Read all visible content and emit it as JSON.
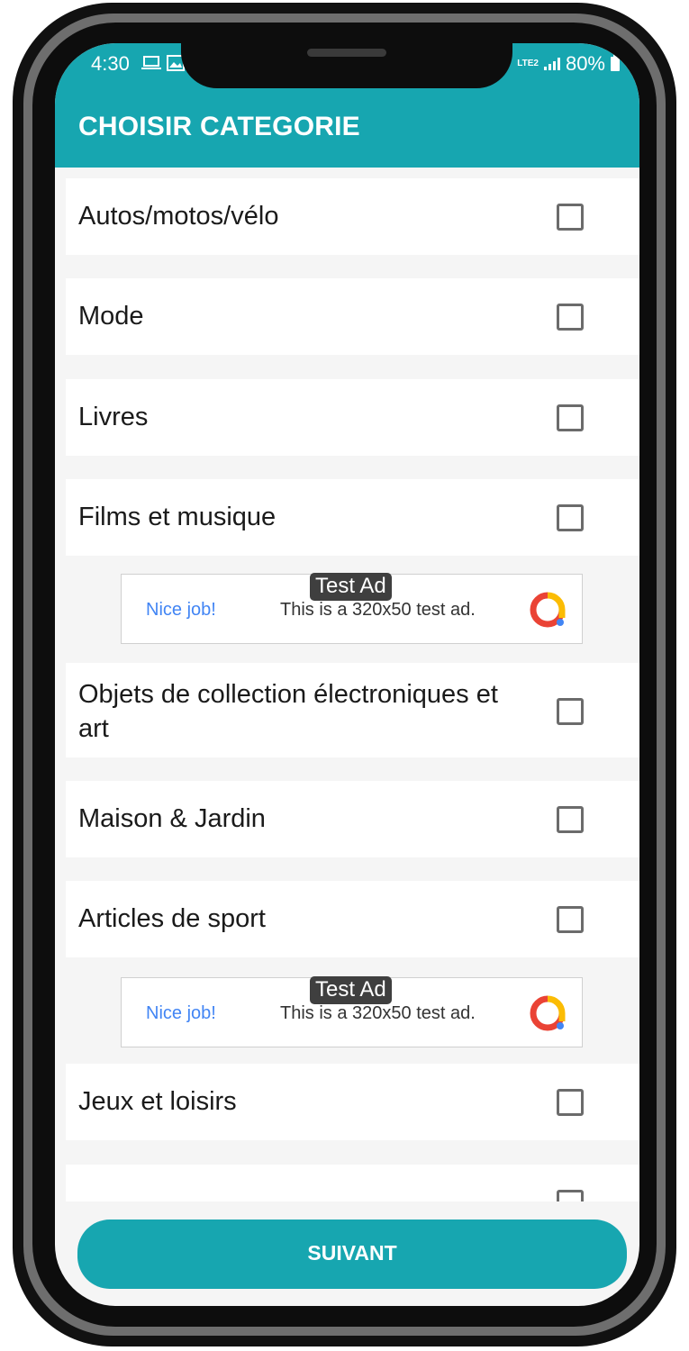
{
  "status_bar": {
    "time": "4:30",
    "left_icons": "laptop-icon, image-icon",
    "network": "LTE2",
    "battery": "80%"
  },
  "app_bar": {
    "title": "CHOISIR CATEGORIE"
  },
  "categories": [
    {
      "label": "Autos/motos/vélo",
      "checked": false
    },
    {
      "label": "Mode",
      "checked": false
    },
    {
      "label": "Livres",
      "checked": false
    },
    {
      "label": "Films et musique",
      "checked": false
    },
    {
      "label": "Objets de collection électroniques et art",
      "checked": false
    },
    {
      "label": "Maison & Jardin",
      "checked": false
    },
    {
      "label": "Articles de sport",
      "checked": false
    },
    {
      "label": "Jeux et loisirs",
      "checked": false
    }
  ],
  "ads": [
    {
      "tag": "Test Ad",
      "headline": "Nice job!",
      "text": "This is a 320x50 test ad."
    },
    {
      "tag": "Test Ad",
      "headline": "Nice job!",
      "text": "This is a 320x50 test ad."
    }
  ],
  "footer": {
    "next_label": "SUIVANT"
  },
  "colors": {
    "primary": "#17a6b0",
    "background": "#f5f5f5",
    "text": "#1a1a1a"
  }
}
